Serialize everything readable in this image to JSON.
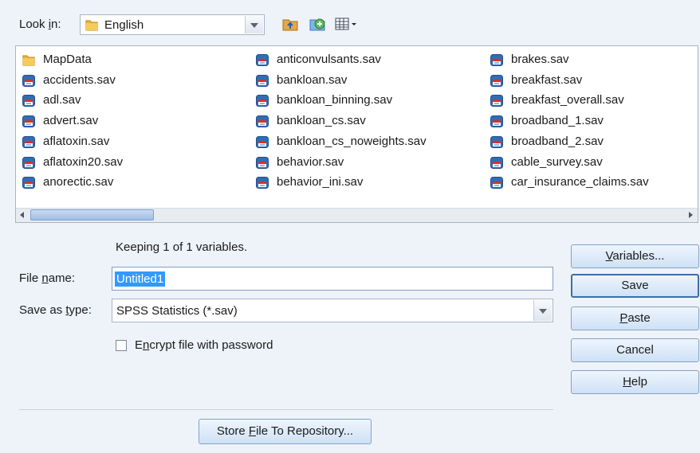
{
  "look_in": {
    "label": "Look in:",
    "label_pre": "Look ",
    "label_mnemonic": "i",
    "label_post": "n:",
    "value": "English"
  },
  "toolbar": {
    "up_icon": "up-one-level-icon",
    "new_folder_icon": "create-new-folder-icon",
    "view_menu_icon": "view-menu-icon"
  },
  "files": {
    "col1": [
      "MapData",
      "accidents.sav",
      "adl.sav",
      "advert.sav",
      "aflatoxin.sav",
      "aflatoxin20.sav",
      "anorectic.sav"
    ],
    "col2": [
      "anticonvulsants.sav",
      "bankloan.sav",
      "bankloan_binning.sav",
      "bankloan_cs.sav",
      "bankloan_cs_noweights.sav",
      "behavior.sav",
      "behavior_ini.sav"
    ],
    "col3": [
      "brakes.sav",
      "breakfast.sav",
      "breakfast_overall.sav",
      "broadband_1.sav",
      "broadband_2.sav",
      "cable_survey.sav",
      "car_insurance_claims.sav"
    ]
  },
  "status": "Keeping 1 of 1 variables.",
  "file_name": {
    "label_pre": "File ",
    "label_mnemonic": "n",
    "label_post": "ame:",
    "value": "Untitled1"
  },
  "save_type": {
    "label_pre": "Save as ",
    "label_mnemonic": "t",
    "label_post": "ype:",
    "value": "SPSS Statistics (*.sav)"
  },
  "encrypt": {
    "label_pre": "E",
    "label_mnemonic": "n",
    "label_post": "crypt file with password",
    "checked": false
  },
  "buttons": {
    "variables": {
      "pre": "",
      "mn": "V",
      "post": "ariables..."
    },
    "save": {
      "pre": "Save",
      "mn": "",
      "post": ""
    },
    "paste": {
      "pre": "",
      "mn": "P",
      "post": "aste"
    },
    "cancel": {
      "pre": "Cancel",
      "mn": "",
      "post": ""
    },
    "help": {
      "pre": "",
      "mn": "H",
      "post": "elp"
    },
    "repository": {
      "pre": "Store ",
      "mn": "F",
      "post": "ile To Repository..."
    }
  },
  "colors": {
    "background": "#eef3fa",
    "selection": "#3399ff",
    "button_border": "#7fa3c8",
    "sav_icon_red": "#d9302a",
    "sav_icon_blue": "#2f6db5",
    "folder_yellow": "#e9b53c"
  }
}
